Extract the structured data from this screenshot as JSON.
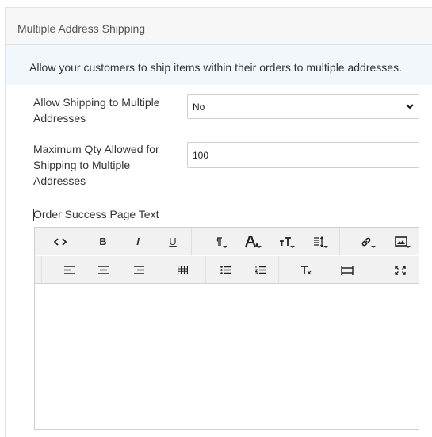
{
  "panel": {
    "title": "Multiple Address Shipping"
  },
  "info": {
    "text": "Allow your customers to ship items within their orders to multiple addresses."
  },
  "fields": {
    "allow_multiple": {
      "label": "Allow Shipping to Multiple Addresses",
      "value": "No"
    },
    "max_qty": {
      "label": "Maximum Qty Allowed for Shipping to Multiple Addresses",
      "value": "100"
    },
    "success_text": {
      "label": "Order Success Page Text"
    }
  },
  "toolbar": {
    "row1": [
      "code-view",
      "bold",
      "italic",
      "underline",
      "paragraph-style",
      "font-color",
      "font-size",
      "line-height",
      "insert-link",
      "insert-image"
    ],
    "row2": [
      "align-left",
      "align-center",
      "align-right",
      "insert-table",
      "bulleted-list",
      "numbered-list",
      "clear-formatting",
      "horizontal-rule",
      "fullscreen"
    ],
    "labels": {
      "bold": "B",
      "italic": "I",
      "underline": "U"
    }
  }
}
